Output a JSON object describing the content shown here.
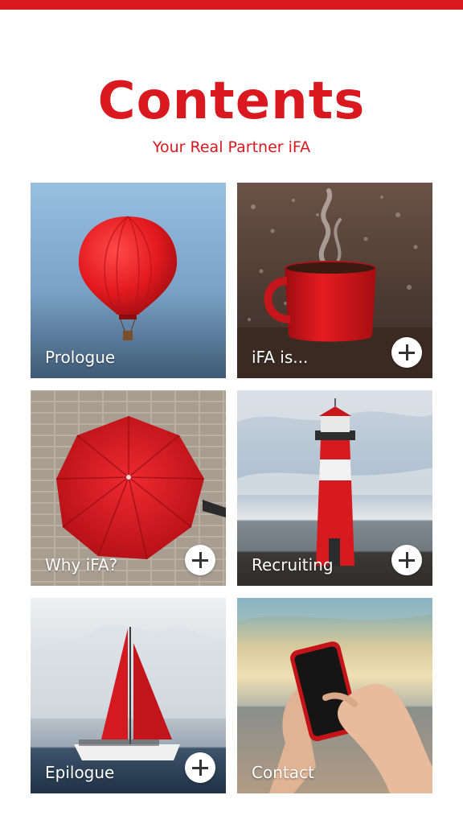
{
  "header": {
    "title": "Contents",
    "subtitle": "Your Real Partner iFA",
    "accent_color": "#d9181f"
  },
  "tiles": [
    {
      "label": "Prologue",
      "image": "hot-air-balloon",
      "has_expand": false
    },
    {
      "label": "iFA is...",
      "image": "red-coffee-mug",
      "has_expand": true,
      "expand_icon": "plus-icon"
    },
    {
      "label": "Why iFA?",
      "image": "red-umbrella",
      "has_expand": true,
      "expand_icon": "plus-icon"
    },
    {
      "label": "Recruiting",
      "image": "red-lighthouse",
      "has_expand": true,
      "expand_icon": "plus-icon"
    },
    {
      "label": "Epilogue",
      "image": "red-sailboat",
      "has_expand": true,
      "expand_icon": "plus-icon"
    },
    {
      "label": "Contact",
      "image": "red-smartphone",
      "has_expand": false
    }
  ]
}
